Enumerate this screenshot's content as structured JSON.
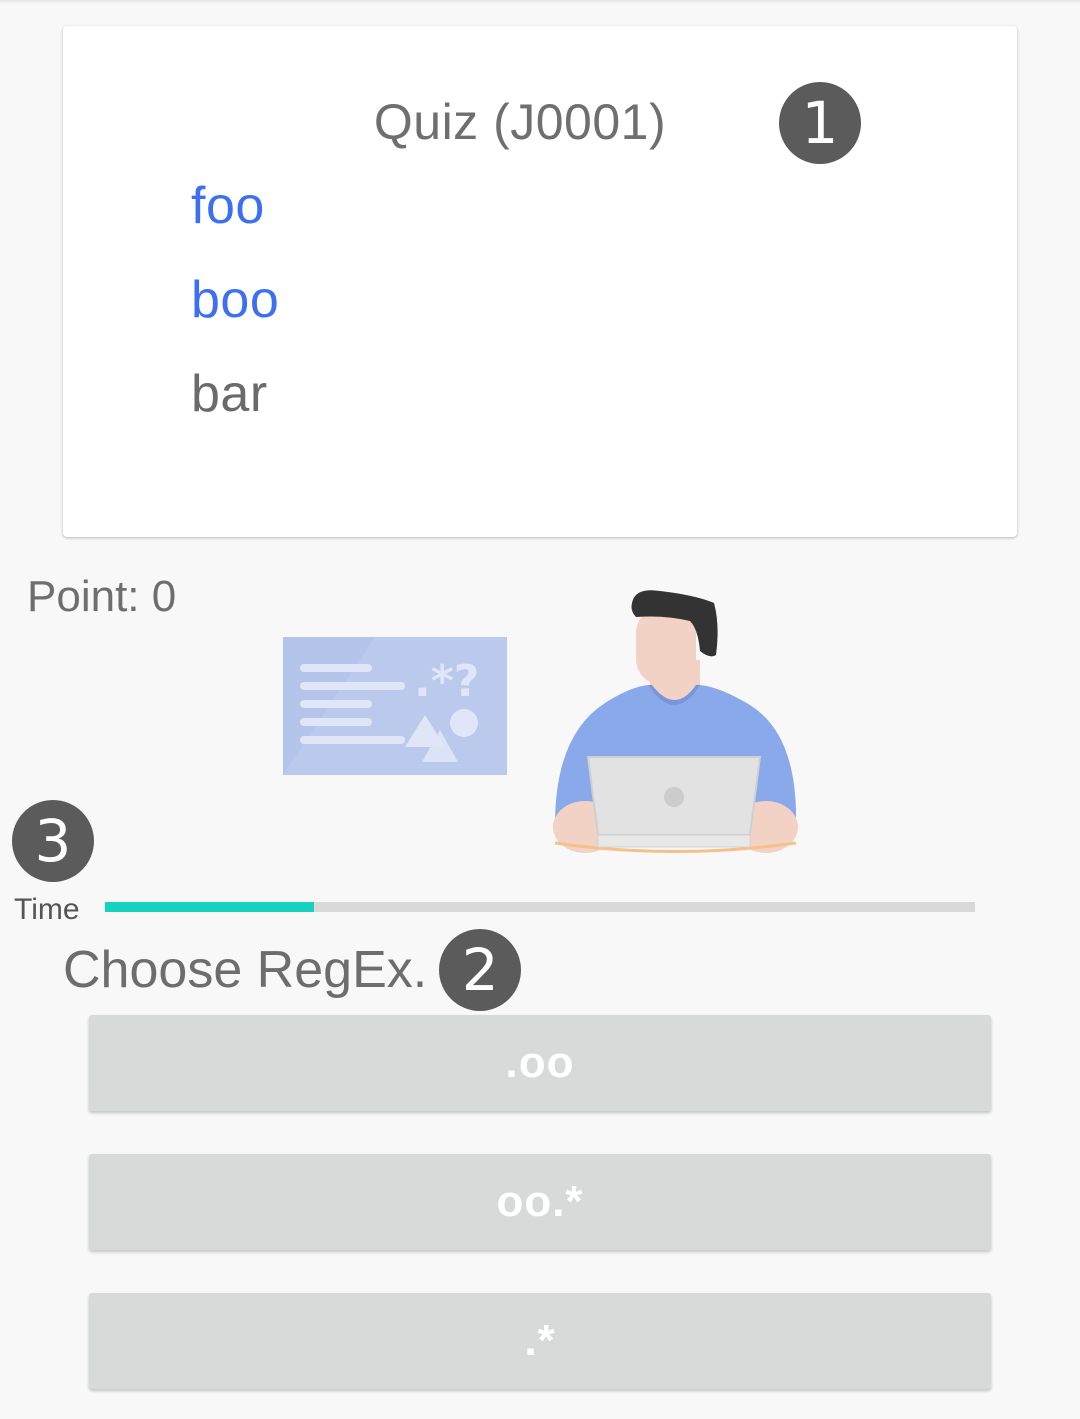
{
  "quiz": {
    "title": "Quiz  (J0001)",
    "badge": "1",
    "test_strings": [
      {
        "text": "foo",
        "matched": true
      },
      {
        "text": "boo",
        "matched": true
      },
      {
        "text": "bar",
        "matched": false
      }
    ]
  },
  "score": {
    "label": "Point: 0"
  },
  "timer": {
    "badge": "3",
    "label": "Time",
    "progress": 0.24
  },
  "prompt": {
    "label": "Choose RegEx.",
    "badge": "2"
  },
  "options": [
    ".oo",
    "oo.*",
    ".*"
  ],
  "illustration": {
    "board_symbols": ".*?"
  },
  "colors": {
    "match": "#3d6ff2",
    "nomatch": "#6a6a6a",
    "progress": "#15d3c0",
    "badge": "#5b5b5b",
    "button": "#d8d9d9"
  }
}
